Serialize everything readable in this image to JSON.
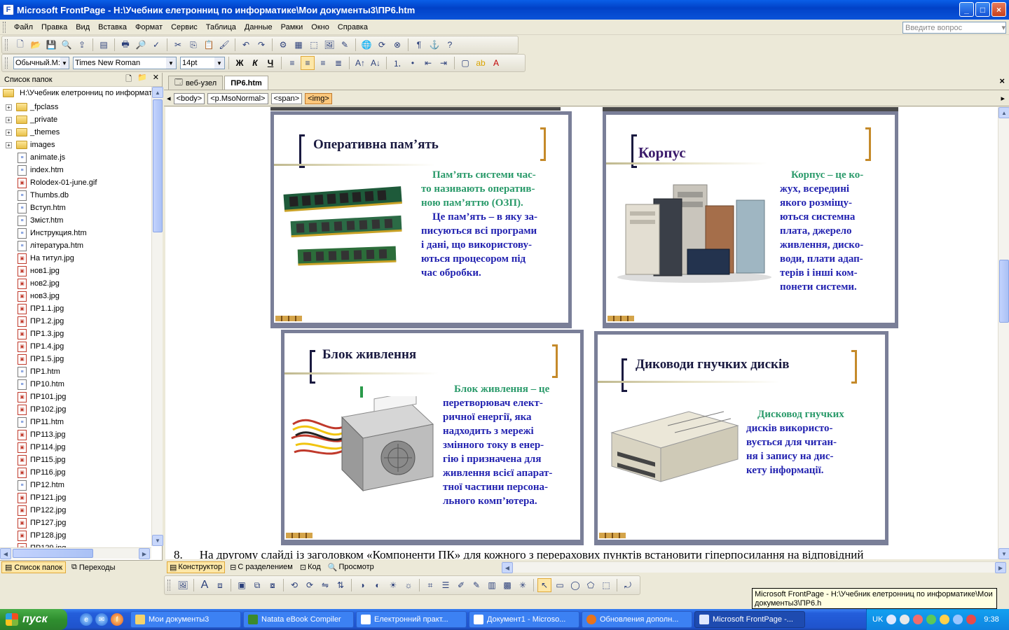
{
  "window": {
    "title": "Microsoft FrontPage - H:\\Учебник елетронниц по информатике\\Мои документы3\\ПР6.htm",
    "buttons": {
      "minimize": "_",
      "maximize": "□",
      "close": "×"
    }
  },
  "menu": {
    "items": [
      "Файл",
      "Правка",
      "Вид",
      "Вставка",
      "Формат",
      "Сервис",
      "Таблица",
      "Данные",
      "Рамки",
      "Окно",
      "Справка"
    ],
    "help_placeholder": "Введите вопрос"
  },
  "format_toolbar": {
    "style": "Обычный.M:",
    "font": "Times New Roman",
    "size": "14pt",
    "bold": "Ж",
    "italic": "К",
    "underline": "Ч"
  },
  "folder_pane": {
    "title": "Список папок",
    "root": "H:\\Учебник елетронниц по информат",
    "folders": [
      "_fpclass",
      "_private",
      "_themes",
      "images"
    ],
    "files": [
      {
        "name": "animate.js",
        "kind": "doc"
      },
      {
        "name": "index.htm",
        "kind": "doc"
      },
      {
        "name": "Rolodex-01-june.gif",
        "kind": "img"
      },
      {
        "name": "Thumbs.db",
        "kind": "doc"
      },
      {
        "name": "Вступ.htm",
        "kind": "doc"
      },
      {
        "name": "Зміст.htm",
        "kind": "doc"
      },
      {
        "name": "Инструкция.htm",
        "kind": "doc"
      },
      {
        "name": "література.htm",
        "kind": "doc"
      },
      {
        "name": "На титул.jpg",
        "kind": "img"
      },
      {
        "name": "нов1.jpg",
        "kind": "img"
      },
      {
        "name": "нов2.jpg",
        "kind": "img"
      },
      {
        "name": "нов3.jpg",
        "kind": "img"
      },
      {
        "name": "ПР1.1.jpg",
        "kind": "img"
      },
      {
        "name": "ПР1.2.jpg",
        "kind": "img"
      },
      {
        "name": "ПР1.3.jpg",
        "kind": "img"
      },
      {
        "name": "ПР1.4.jpg",
        "kind": "img"
      },
      {
        "name": "ПР1.5.jpg",
        "kind": "img"
      },
      {
        "name": "ПР1.htm",
        "kind": "doc"
      },
      {
        "name": "ПР10.htm",
        "kind": "doc"
      },
      {
        "name": "ПР101.jpg",
        "kind": "img"
      },
      {
        "name": "ПР102.jpg",
        "kind": "img"
      },
      {
        "name": "ПР11.htm",
        "kind": "doc"
      },
      {
        "name": "ПР113.jpg",
        "kind": "img"
      },
      {
        "name": "ПР114.jpg",
        "kind": "img"
      },
      {
        "name": "ПР115.jpg",
        "kind": "img"
      },
      {
        "name": "ПР116.jpg",
        "kind": "img"
      },
      {
        "name": "ПР12.htm",
        "kind": "doc"
      },
      {
        "name": "ПР121.jpg",
        "kind": "img"
      },
      {
        "name": "ПР122.jpg",
        "kind": "img"
      },
      {
        "name": "ПР127.jpg",
        "kind": "img"
      },
      {
        "name": "ПР128.jpg",
        "kind": "img"
      },
      {
        "name": "ПР129.jpg",
        "kind": "img"
      }
    ],
    "tabs": {
      "folders": "Список папок",
      "navigation": "Переходы"
    }
  },
  "doc_tabs": {
    "site": "веб-узел",
    "page": "ПР6.htm",
    "close": "×"
  },
  "tag_path": [
    "<body>",
    "<p.MsoNormal>",
    "<span>",
    "<img>"
  ],
  "slides": {
    "ram": {
      "title": "Оперативна пам’ять",
      "lines": [
        {
          "t": "Пам’ять системи час-",
          "c": "g"
        },
        {
          "t": "то називають оператив-",
          "c": "g"
        },
        {
          "t": "ною пам’яттю (ОЗП).",
          "c": "g"
        },
        {
          "t": "Це пам’ять – в яку за-",
          "c": "b"
        },
        {
          "t": "писуються всі програми",
          "c": "b"
        },
        {
          "t": "і дані, що використову-",
          "c": "b"
        },
        {
          "t": "ються процесором під",
          "c": "b"
        },
        {
          "t": "час обробки.",
          "c": "b"
        }
      ]
    },
    "case": {
      "title": "Корпус",
      "lines": [
        {
          "t": "Корпус – це ко-",
          "c": "g"
        },
        {
          "t": "жух, всередині",
          "c": "b"
        },
        {
          "t": "якого розміщу-",
          "c": "b"
        },
        {
          "t": "ються системна",
          "c": "b"
        },
        {
          "t": "плата, джерело",
          "c": "b"
        },
        {
          "t": "живлення, диско-",
          "c": "b"
        },
        {
          "t": "води, плати адап-",
          "c": "b"
        },
        {
          "t": "терів і інші ком-",
          "c": "b"
        },
        {
          "t": "понети системи.",
          "c": "b"
        }
      ]
    },
    "psu": {
      "title": "Блок живлення",
      "lines": [
        {
          "t": "Блок живлення – це",
          "c": "g"
        },
        {
          "t": "перетворювач елект-",
          "c": "b"
        },
        {
          "t": "ричної енергії, яка",
          "c": "b"
        },
        {
          "t": "надходить  з мережі",
          "c": "b"
        },
        {
          "t": "змінного току в енер-",
          "c": "b"
        },
        {
          "t": "гію і  призначена для",
          "c": "b"
        },
        {
          "t": "живлення всієї апарат-",
          "c": "b"
        },
        {
          "t": "тної частини персона-",
          "c": "b"
        },
        {
          "t": "льного  комп’ютера.",
          "c": "b"
        }
      ]
    },
    "fdd": {
      "title": "Диководи гнучких дисків",
      "lines": [
        {
          "t": "Дисковод гнучких",
          "c": "g"
        },
        {
          "t": "дисків використо-",
          "c": "b"
        },
        {
          "t": "вується для читан-",
          "c": "b"
        },
        {
          "t": "ня і запису на дис-",
          "c": "b"
        },
        {
          "t": "кету інформації.",
          "c": "b"
        }
      ]
    }
  },
  "body_text": {
    "num": "8.",
    "text": "На другому слайді із заголовком «Компоненти  ПК» для кожного  з перерахових пунктів встановити  гіперпосилання на відповідний"
  },
  "view_tabs": {
    "design": "Конструктор",
    "split": "С разделением",
    "code": "Код",
    "preview": "Просмотр"
  },
  "tooltip": {
    "line1": "Microsoft FrontPage - H:\\Учебник елетронниц по информатике\\Мои",
    "line2": "документы3\\ПР6.h"
  },
  "taskbar": {
    "start": "пуск",
    "tasks": [
      "Мои документы3",
      "Natata eBook Compiler",
      "Електронний практ...",
      "Документ1 - Microso...",
      "Обновления дополн...",
      "Microsoft FrontPage -..."
    ],
    "lang": "UK",
    "time": "9:38"
  }
}
